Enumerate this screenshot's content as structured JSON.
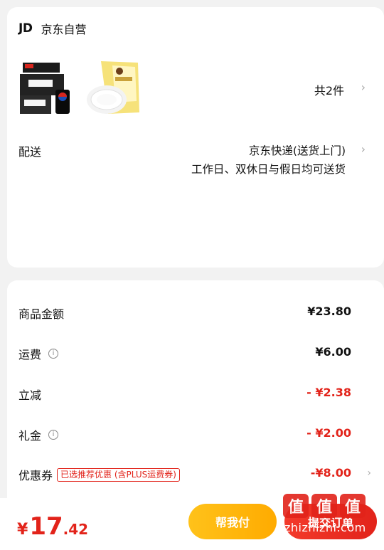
{
  "store": {
    "logo": "JD",
    "name": "京东自营"
  },
  "products": [
    {
      "name": "pepsi-box-image"
    },
    {
      "name": "corn-starch-bag-image"
    }
  ],
  "item_count": "共2件",
  "delivery": {
    "label": "配送",
    "method": "京东快递(送货上门)",
    "note": "工作日、双休日与假日均可送货"
  },
  "price_summary": {
    "goods": {
      "label": "商品金额",
      "value": "¥23.80"
    },
    "shipping": {
      "label": "运费",
      "value": "¥6.00"
    },
    "instant_discount": {
      "label": "立减",
      "value": "- ¥2.38"
    },
    "gift_money": {
      "label": "礼金",
      "value": "- ¥2.00"
    },
    "coupon": {
      "label": "优惠券",
      "badge": "已选推荐优惠 (含PLUS运费券)",
      "value": "-¥8.00"
    }
  },
  "total": {
    "currency": "¥",
    "integer": "17",
    "decimal": ".42"
  },
  "buttons": {
    "help_pay": "帮我付",
    "submit": "提交订单"
  },
  "watermark": {
    "logo_chars": [
      "值",
      "值",
      "值"
    ],
    "url": "zhizhizhi.com"
  },
  "colors": {
    "accent_red": "#e2231a",
    "help_yellow": "#ffb800",
    "background": "#f2f2f2"
  }
}
